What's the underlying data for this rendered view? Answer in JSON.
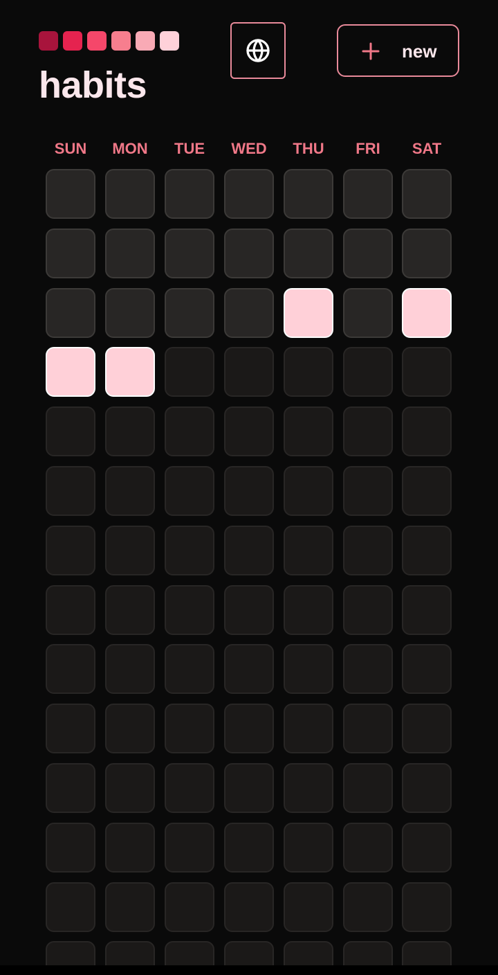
{
  "app": {
    "title": "habits",
    "palette": [
      "#a8143c",
      "#e5234f",
      "#f5476a",
      "#f77e8e",
      "#f9aab5",
      "#ffd1d9"
    ]
  },
  "toolbar": {
    "globe_icon": "globe-icon",
    "new_icon": "plus-icon",
    "new_label": "new",
    "accent_color": "#e98a9a"
  },
  "calendar": {
    "weekdays": [
      "SUN",
      "MON",
      "TUE",
      "WED",
      "THU",
      "FRI",
      "SAT"
    ],
    "weekday_color": "#f07888",
    "weeks": [
      [
        "past",
        "past",
        "past",
        "past",
        "past",
        "past",
        "past"
      ],
      [
        "past",
        "past",
        "past",
        "past",
        "past",
        "past",
        "past"
      ],
      [
        "past",
        "past",
        "past",
        "past",
        "done",
        "past",
        "done"
      ],
      [
        "done",
        "done",
        "future",
        "future",
        "future",
        "future",
        "future"
      ],
      [
        "future",
        "future",
        "future",
        "future",
        "future",
        "future",
        "future"
      ],
      [
        "future",
        "future",
        "future",
        "future",
        "future",
        "future",
        "future"
      ],
      [
        "future",
        "future",
        "future",
        "future",
        "future",
        "future",
        "future"
      ],
      [
        "future",
        "future",
        "future",
        "future",
        "future",
        "future",
        "future"
      ],
      [
        "future",
        "future",
        "future",
        "future",
        "future",
        "future",
        "future"
      ],
      [
        "future",
        "future",
        "future",
        "future",
        "future",
        "future",
        "future"
      ],
      [
        "future",
        "future",
        "future",
        "future",
        "future",
        "future",
        "future"
      ],
      [
        "future",
        "future",
        "future",
        "future",
        "future",
        "future",
        "future"
      ],
      [
        "future",
        "future",
        "future",
        "future",
        "future",
        "future",
        "future"
      ],
      [
        "future",
        "future",
        "future",
        "future",
        "future",
        "future",
        "future"
      ]
    ],
    "state_colors": {
      "past": "#282625",
      "future": "#1b1918",
      "done": "#ffd0d8"
    }
  }
}
